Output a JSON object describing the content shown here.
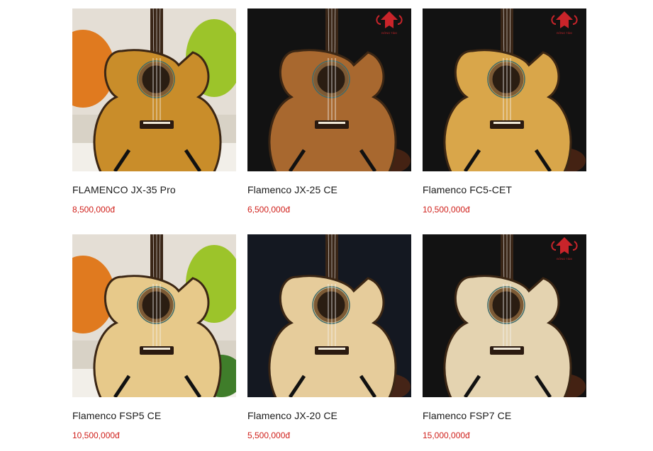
{
  "products": [
    {
      "name": "FLAMENCO JX-35 Pro",
      "price": "8,500,000đ",
      "scene": "light-pillows",
      "top": "#c98d2a",
      "logo": false
    },
    {
      "name": "Flamenco JX-25 CE",
      "price": "6,500,000đ",
      "scene": "dark",
      "top": "#a8682f",
      "logo": true
    },
    {
      "name": "Flamenco FC5-CET",
      "price": "10,500,000đ",
      "scene": "dark",
      "top": "#d9a64a",
      "logo": true
    },
    {
      "name": "Flamenco FSP5 CE",
      "price": "10,500,000đ",
      "scene": "light-pillows-plant",
      "top": "#e7c98a",
      "logo": false
    },
    {
      "name": "Flamenco JX-20 CE",
      "price": "5,500,000đ",
      "scene": "dark-blue",
      "top": "#e6cc9b",
      "logo": false
    },
    {
      "name": "Flamenco FSP7 CE",
      "price": "15,000,000đ",
      "scene": "dark",
      "top": "#e4d3b0",
      "logo": true
    }
  ],
  "colors": {
    "price": "#d0201b",
    "name": "#1a1a1a"
  },
  "logo_text": "ĐÔNG TÂM"
}
